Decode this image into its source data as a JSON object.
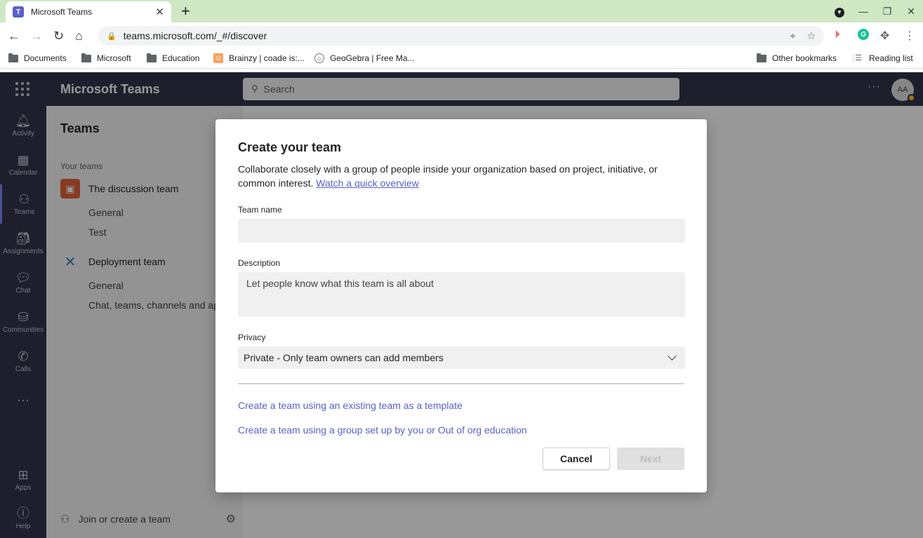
{
  "browser": {
    "tab_title": "Microsoft Teams",
    "tab_favicon": "T",
    "url": "teams.microsoft.com/_#/discover",
    "bookmarks": [
      {
        "label": "Documents",
        "icon": "folder-icon"
      },
      {
        "label": "Microsoft",
        "icon": "folder-icon"
      },
      {
        "label": "Education",
        "icon": "folder-icon"
      },
      {
        "label": "Brainzy | coade is:...",
        "icon": "brainzy-icon"
      },
      {
        "label": "GeoGebra | Free Ma...",
        "icon": "geogebra-icon"
      }
    ],
    "other_bookmarks": "Other bookmarks",
    "reading_list": "Reading list",
    "grammarly_letter": "G"
  },
  "app": {
    "name": "Microsoft Teams",
    "search_placeholder": "Search",
    "avatar_initials": "AA",
    "rail": [
      {
        "label": "Activity",
        "icon": "bell-icon"
      },
      {
        "label": "Calendar",
        "icon": "calendar-icon"
      },
      {
        "label": "Teams",
        "icon": "teams-icon",
        "active": true
      },
      {
        "label": "Assignments",
        "icon": "assignments-icon"
      },
      {
        "label": "Chat",
        "icon": "chat-icon"
      },
      {
        "label": "Communities",
        "icon": "communities-icon"
      },
      {
        "label": "Calls",
        "icon": "phone-icon"
      },
      {
        "label": "Apps",
        "icon": "apps-icon"
      },
      {
        "label": "Help",
        "icon": "help-icon"
      }
    ]
  },
  "teams_pane": {
    "title": "Teams",
    "section_label": "Your teams",
    "teams": [
      {
        "name": "The discussion team",
        "channels": [
          "General",
          "Test"
        ]
      },
      {
        "name": "Deployment team",
        "channels": [
          "General",
          "Chat, teams, channels and apps"
        ]
      }
    ],
    "footer_label": "Join or create a team"
  },
  "dialog": {
    "title": "Create your team",
    "description": "Collaborate closely with a group of people inside your organization based on project, initiative, or common interest.",
    "overview_link": "Watch a quick overview",
    "team_name_label": "Team name",
    "team_name_value": "",
    "description_label": "Description",
    "description_placeholder": "Let people know what this team is all about",
    "privacy_label": "Privacy",
    "privacy_value": "Private - Only team owners can add members",
    "template_link": "Create a team using an existing team as a template",
    "group_link": "Create a team using a group set up by you or Out of org education",
    "cancel_label": "Cancel",
    "next_label": "Next"
  },
  "colors": {
    "tabstrip": "#cfe8c4",
    "teams_header": "#33344a",
    "accent": "#5b5fc7"
  }
}
